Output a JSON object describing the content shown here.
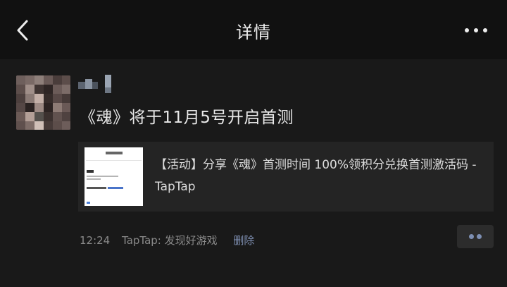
{
  "header": {
    "title": "详情"
  },
  "post": {
    "text": "《魂》将于11月5号开启首测",
    "link_card": {
      "title": "【活动】分享《魂》首测时间 100%领积分兑换首测激活码 - TapTap"
    },
    "meta": {
      "time": "12:24",
      "source": "TapTap: 发现好游戏",
      "delete_label": "删除"
    }
  }
}
